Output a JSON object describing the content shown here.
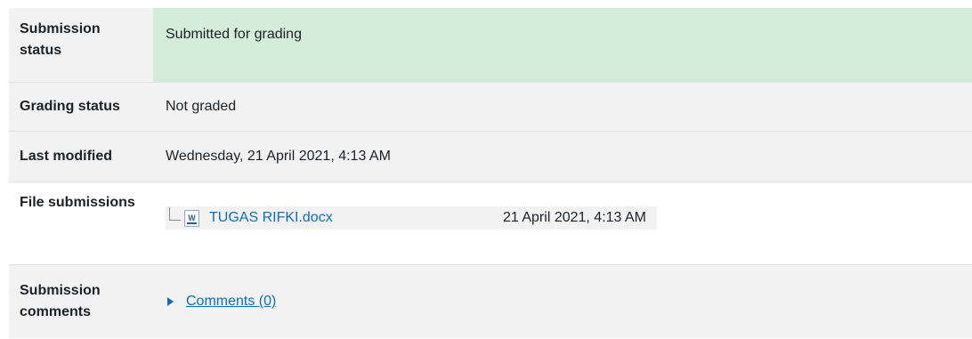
{
  "rows": {
    "submission_status": {
      "label": "Submission status",
      "value": "Submitted for grading"
    },
    "grading_status": {
      "label": "Grading status",
      "value": "Not graded"
    },
    "last_modified": {
      "label": "Last modified",
      "value": "Wednesday, 21 April 2021, 4:13 AM"
    },
    "file_submissions": {
      "label": "File submissions",
      "files": [
        {
          "name": "TUGAS RIFKI.docx",
          "date": "21 April 2021, 4:13 AM",
          "icon": "word-doc-icon",
          "icon_glyph": "W"
        }
      ]
    },
    "submission_comments": {
      "label": "Submission comments",
      "link": "Comments (0)"
    }
  },
  "colors": {
    "submitted_bg": "#d4edda",
    "row_gray": "#f2f2f2",
    "link": "#0f6cbf"
  }
}
